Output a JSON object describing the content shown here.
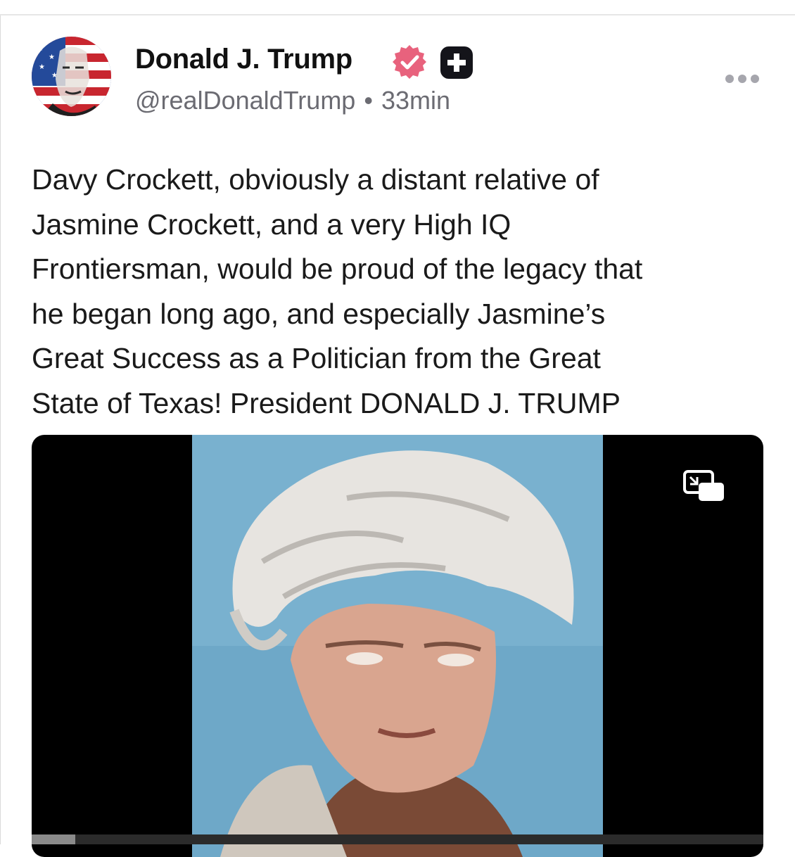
{
  "post": {
    "author_name": "Donald J. Trump",
    "handle": "@realDonaldTrump",
    "separator": "•",
    "timestamp": "33min",
    "text": "Davy Crockett, obviously a distant relative of\nJasmine Crockett, and a very High IQ\nFrontiersman, would be proud of the legacy that\nhe began long ago, and especially Jasmine’s\nGreat Success as a Politician from the Great\nState of Texas! President DONALD J. TRUMP",
    "verified_icon": "verified-badge-icon",
    "plus_icon": "plus-badge-icon",
    "more_icon": "more-options-icon"
  },
  "video": {
    "pip_icon": "picture-in-picture-icon",
    "progress_fraction": 0.06
  },
  "colors": {
    "verified_badge": "#e8627d",
    "handle_gray": "#6b6b72",
    "video_background": "#000000"
  }
}
